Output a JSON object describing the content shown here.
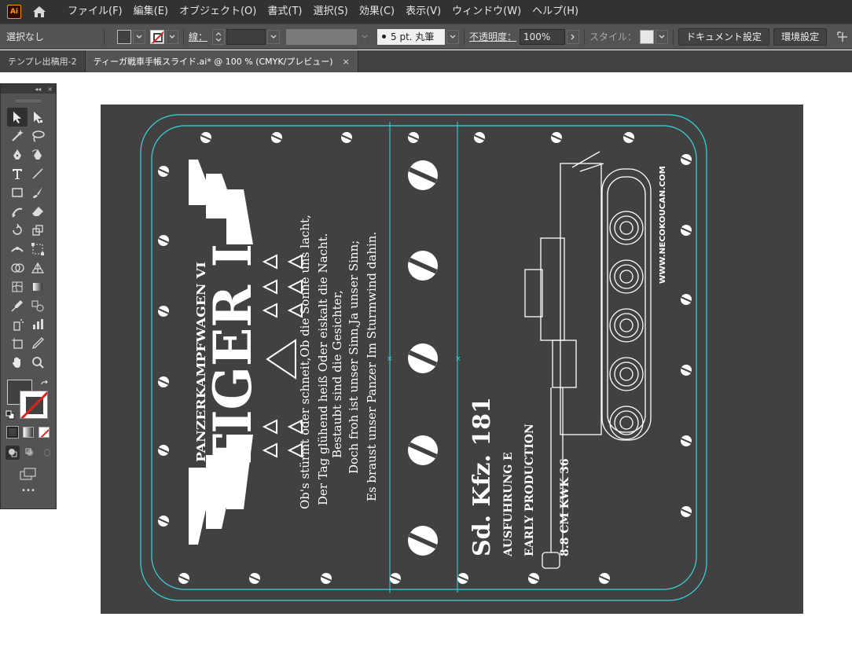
{
  "app": {
    "logo": "Ai",
    "menus": [
      "ファイル(F)",
      "編集(E)",
      "オブジェクト(O)",
      "書式(T)",
      "選択(S)",
      "効果(C)",
      "表示(V)",
      "ウィンドウ(W)",
      "ヘルプ(H)"
    ]
  },
  "controlbar": {
    "selection": "選択なし",
    "stroke_label": "線：",
    "brush": "5 pt. 丸筆",
    "opacity_label": "不透明度：",
    "opacity": "100%",
    "style_label": "スタイル：",
    "document_setup": "ドキュメント設定",
    "preferences": "環境設定"
  },
  "tabs": [
    {
      "label": "テンプレ出稿用-2"
    },
    {
      "label": "ティーガ戦車手帳スライド.ai* @ 100 % (CMYK/プレビュー)",
      "close": "×"
    }
  ],
  "tools_panel": {
    "collapse": "◂◂",
    "close": "×",
    "more": "•••",
    "tools": [
      [
        "selection-tool-icon",
        "direct-selection-tool-icon"
      ],
      [
        "magic-wand-tool-icon",
        "lasso-tool-icon"
      ],
      [
        "pen-tool-icon",
        "curvature-tool-icon"
      ],
      [
        "type-tool-icon",
        "line-segment-tool-icon"
      ],
      [
        "rectangle-tool-icon",
        "paintbrush-tool-icon"
      ],
      [
        "shaper-tool-icon",
        "eraser-tool-icon"
      ],
      [
        "rotate-tool-icon",
        "scale-tool-icon"
      ],
      [
        "width-tool-icon",
        "free-transform-tool-icon"
      ],
      [
        "shape-builder-tool-icon",
        "perspective-grid-tool-icon"
      ],
      [
        "mesh-tool-icon",
        "gradient-tool-icon"
      ],
      [
        "eyedropper-tool-icon",
        "blend-tool-icon"
      ],
      [
        "symbol-sprayer-tool-icon",
        "column-graph-tool-icon"
      ],
      [
        "artboard-tool-icon",
        "slice-tool-icon"
      ],
      [
        "hand-tool-icon",
        "zoom-tool-icon"
      ]
    ]
  },
  "artwork": {
    "subtitle": "PANZERKAMPFWAGEN VI",
    "title": "TIGER I",
    "verse": [
      "Ob's stürmt oder schneit,Ob die Sonne uns lacht,",
      "Der Tag glühend heiß Oder eiskalt die Nacht.",
      "Bestaubt sind die Gesichter,",
      "Doch froh ist unser Sinn,Ja unser Sinn;",
      "Es braust unser Panzer Im Sturmwind dahin."
    ],
    "designation": "Sd. Kfz. 181",
    "variant": "AUSFUHRUNG E",
    "production": "EARLY PRODUCTION",
    "gun": "8.8 CM KWK 36",
    "website": "WWW.NECOKOUCAN.COM"
  },
  "colors": {
    "artboard": "#414141",
    "guide": "#3ad6e0",
    "ink": "#ffffff"
  }
}
